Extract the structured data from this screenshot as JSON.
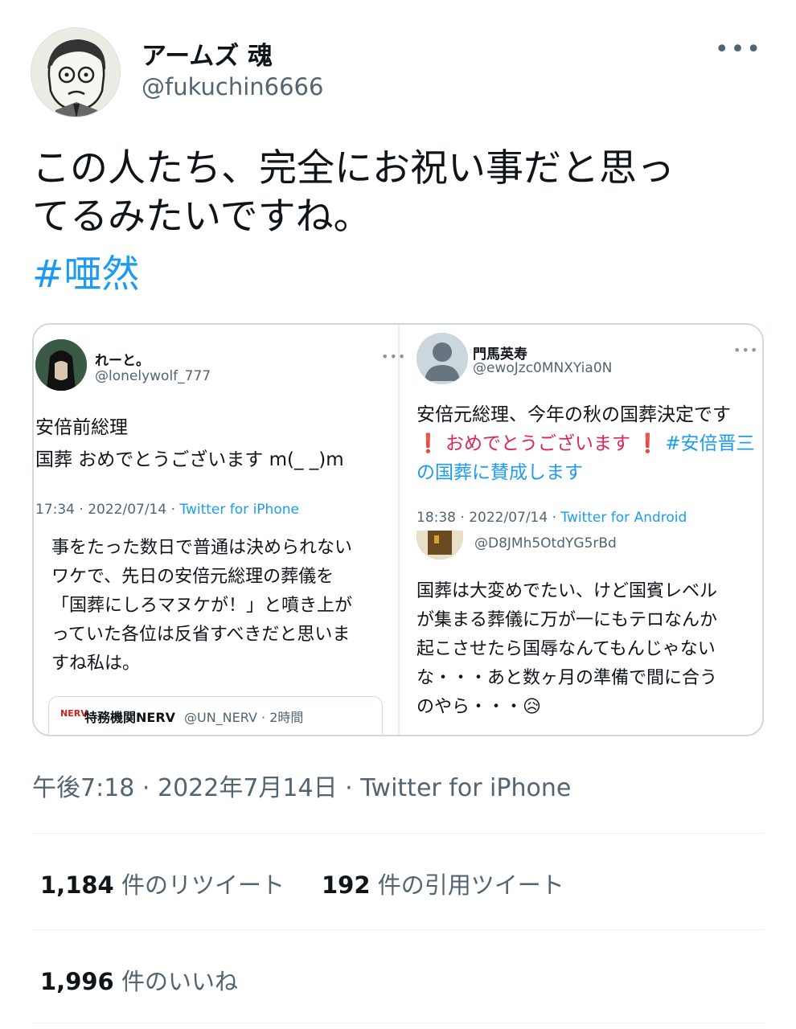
{
  "author": {
    "name": "アームズ 魂",
    "handle": "@fukuchin6666",
    "more_label": "•••"
  },
  "tweet": {
    "text_line1": "この人たち、完全にお祝い事だと思っ",
    "text_line2": "てるみたいですね。",
    "hashtag": "#唖然"
  },
  "embedded": {
    "left": {
      "name": "れーと。",
      "handle": "@lonelywolf_777",
      "more": "•••",
      "body_line1": "安倍前総理",
      "body_line2": "国葬 おめでとうございます m(_ _)m",
      "meta_time": "17:34 · 2022/07/14 · ",
      "meta_source": "Twitter for iPhone",
      "quote_lines": [
        "事をたった数日で普通は決められない",
        "ワケで、先日の安倍元総理の葬儀を",
        "「国葬にしろマヌケが！」と噴き上が",
        "っていた各位は反省すべきだと思いま",
        "すね私は。"
      ],
      "quote_card_logo": "NERV",
      "quote_card_name": "特務機関NERV",
      "quote_card_handle": "@UN_NERV · 2時間"
    },
    "right": {
      "name": "門馬英寿",
      "handle": "@ewoJzc0MNXYia0N",
      "more": "•••",
      "body_line1": "安倍元総理、今年の秋の国葬決定です",
      "body_line2_pre": "❗ おめでとうございます ❗ ",
      "body_line2_link": "#安倍晋三",
      "body_line3_link": "の国葬に賛成します",
      "meta_time": "18:38 · 2022/07/14 · ",
      "meta_source": "Twitter for Android",
      "reply_handle": "@D8JMh5OtdYG5rBd",
      "reply_lines": [
        "国葬は大変めでたい、けど国賓レベル",
        "が集まる葬儀に万が一にもテロなんか",
        "起こさせたら国辱なんてもんじゃない",
        "な・・・あと数ヶ月の準備で間に合う",
        "のやら・・・😥"
      ]
    }
  },
  "timestamp": "午後7:18 · 2022年7月14日 · Twitter for iPhone",
  "stats": {
    "retweets_count": "1,184",
    "retweets_label": " 件のリツイート",
    "quotes_count": "192",
    "quotes_label": " 件の引用ツイート",
    "likes_count": "1,996",
    "likes_label": " 件のいいね"
  }
}
